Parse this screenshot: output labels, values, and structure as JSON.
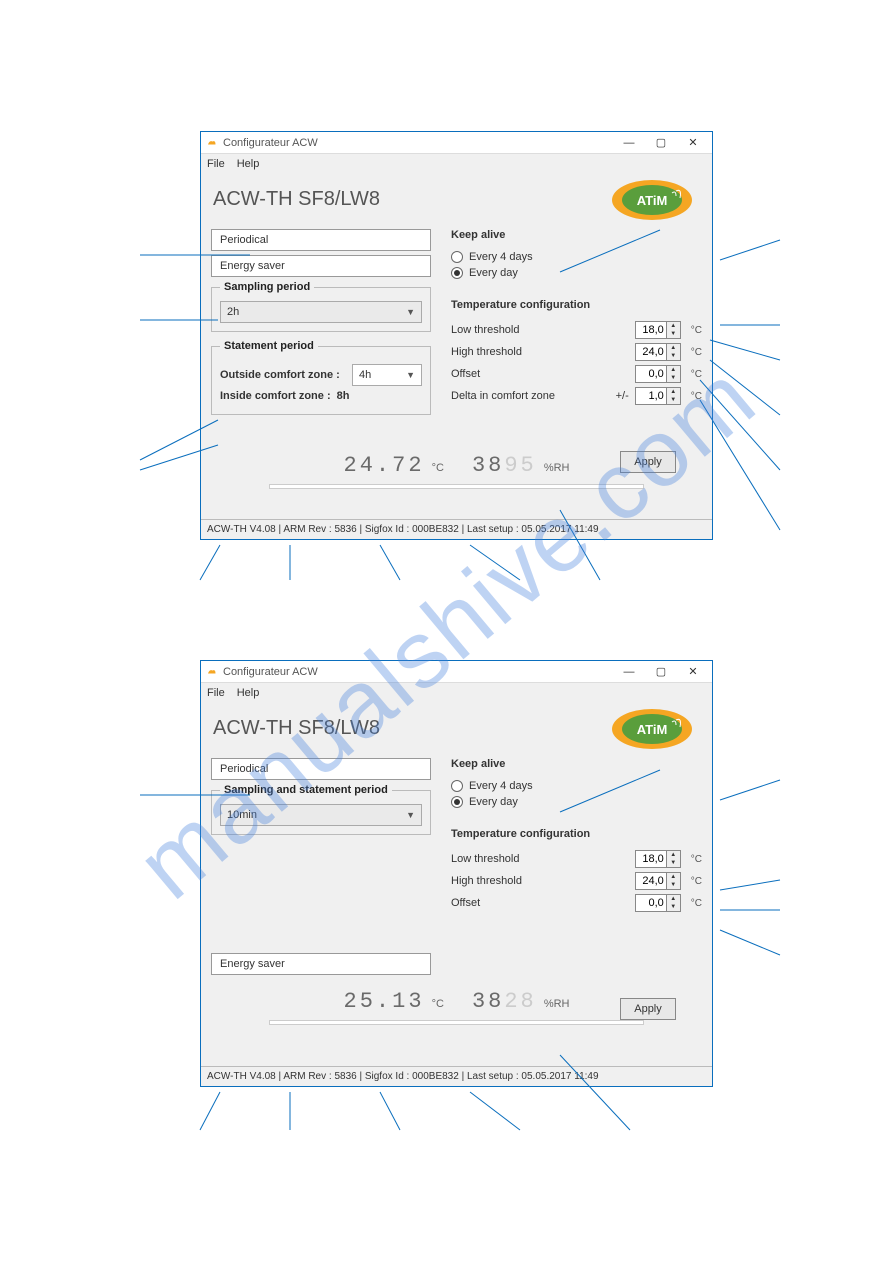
{
  "watermark": "manualshive.com",
  "window_title": "Configurateur ACW",
  "menu": {
    "file": "File",
    "help": "Help"
  },
  "heading": "ACW-TH SF8/LW8",
  "win_controls": {
    "min": "—",
    "max": "▢",
    "close": "✕"
  },
  "tabs": {
    "periodical": "Periodical",
    "energy_saver": "Energy saver"
  },
  "sampling_period": {
    "legend": "Sampling period",
    "value": "2h"
  },
  "sampling_statement_period": {
    "legend": "Sampling and statement period",
    "value": "10min"
  },
  "statement_period": {
    "legend": "Statement period",
    "outside_label": "Outside comfort zone :",
    "outside_value": "4h",
    "inside_label": "Inside comfort zone :",
    "inside_value": "8h"
  },
  "keep_alive": {
    "legend": "Keep alive",
    "opt1": "Every 4 days",
    "opt2": "Every day"
  },
  "temp_config": {
    "legend": "Temperature configuration",
    "low_label": "Low threshold",
    "low_value": "18,0",
    "high_label": "High threshold",
    "high_value": "24,0",
    "offset_label": "Offset",
    "offset_value": "0,0",
    "delta_label": "Delta in comfort zone",
    "delta_prefix": "+/-",
    "delta_value": "1,0",
    "unit": "°C"
  },
  "readout1": {
    "temp": "24.72",
    "temp_unit": "°C",
    "rh_pre": "38",
    "rh_faded": "95",
    "rh_unit": "%RH"
  },
  "readout2": {
    "temp": "25.13",
    "temp_unit": "°C",
    "rh_pre": "38",
    "rh_faded": "28",
    "rh_unit": "%RH"
  },
  "apply": "Apply",
  "status": "ACW-TH V4.08 | ARM Rev : 5836 | Sigfox Id : 000BE832 | Last setup : 05.05.2017 11:49",
  "logo_text": "ATiM"
}
